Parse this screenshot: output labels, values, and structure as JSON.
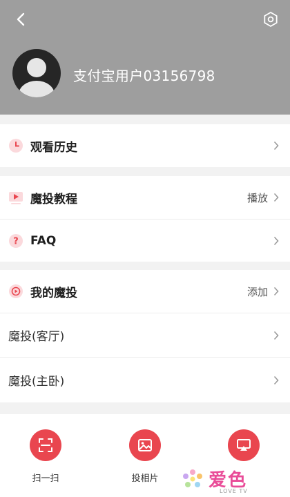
{
  "header": {
    "back_icon": "back-arrow-icon",
    "settings_icon": "hexagon-settings-icon",
    "username": "支付宝用户03156798",
    "header_color": "#9e9e9e"
  },
  "menu": {
    "history": {
      "label": "观看历史",
      "icon": "clock-icon"
    },
    "tutorial": {
      "label": "魔投教程",
      "action": "播放",
      "icon": "video-icon"
    },
    "faq": {
      "label": "FAQ",
      "icon": "question-icon"
    },
    "my_devices": {
      "label": "我的魔投",
      "action": "添加",
      "icon": "cast-circle-icon"
    },
    "devices": [
      {
        "label": "魔投(客厅)"
      },
      {
        "label": "魔投(主卧)"
      }
    ]
  },
  "bottom_actions": [
    {
      "label": "扫一扫",
      "icon": "scan-icon"
    },
    {
      "label": "投相片",
      "icon": "image-icon"
    },
    {
      "label": "",
      "icon": "screen-cast-icon"
    }
  ],
  "watermark": {
    "text": "爱色",
    "sub": "LOVE TV"
  },
  "accent_color": "#e9464f"
}
